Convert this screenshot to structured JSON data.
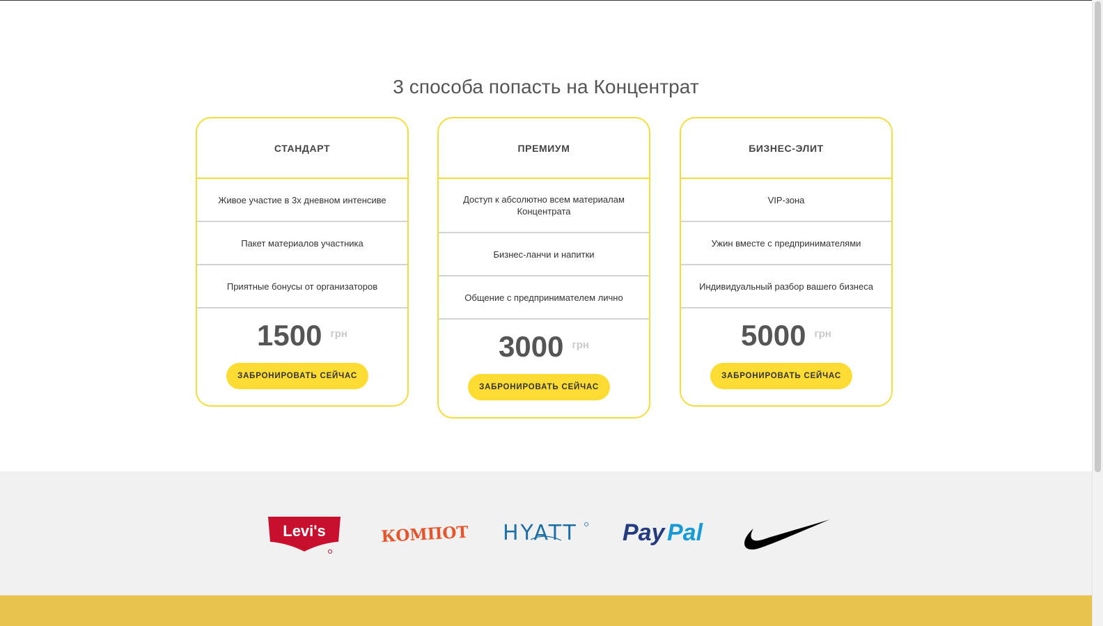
{
  "section": {
    "title": "3 способа попасть на Концентрат"
  },
  "plans": [
    {
      "title": "СТАНДАРТ",
      "features": [
        "Живое участие в 3х дневном интенсиве",
        "Пакет материалов участника",
        "Приятные бонусы от организаторов"
      ],
      "price": "1500",
      "currency": "грн",
      "button_label": "ЗАБРОНИРОВАТЬ СЕЙЧАС"
    },
    {
      "title": "ПРЕМИУМ",
      "features": [
        "Доступ к абсолютно всем материалам Концентрата",
        "Бизнес-ланчи и напитки",
        "Общение с предпринимателем лично"
      ],
      "price": "3000",
      "currency": "грн",
      "button_label": "ЗАБРОНИРОВАТЬ СЕЙЧАС"
    },
    {
      "title": "БИЗНЕС-ЭЛИТ",
      "features": [
        "VIP-зона",
        "Ужин вместе с предпринимателями",
        "Индивидуальный разбор вашего бизнеса"
      ],
      "price": "5000",
      "currency": "грн",
      "button_label": "ЗАБРОНИРОВАТЬ СЕЙЧАС"
    }
  ],
  "partners": {
    "logos": [
      {
        "name": "Levi's",
        "text": "Levi's",
        "icon": "levis-logo",
        "color": "#c8102e"
      },
      {
        "name": "Компот",
        "text": "КОМПОТ",
        "icon": "kompot-logo",
        "color": "#e8542a"
      },
      {
        "name": "Hyatt",
        "text": "HYATT",
        "icon": "hyatt-logo",
        "color": "#1b6fa8"
      },
      {
        "name": "PayPal",
        "text_a": "Pay",
        "text_b": "Pal",
        "icon": "paypal-logo",
        "color_a": "#253b80",
        "color_b": "#179bd7"
      },
      {
        "name": "Nike",
        "icon": "nike-swoosh-logo",
        "color": "#000000"
      }
    ]
  },
  "colors": {
    "accent": "#fcdc32",
    "card_border": "#f6dc3b",
    "footer": "#e8c34e",
    "logos_bg": "#f1f1f1"
  }
}
